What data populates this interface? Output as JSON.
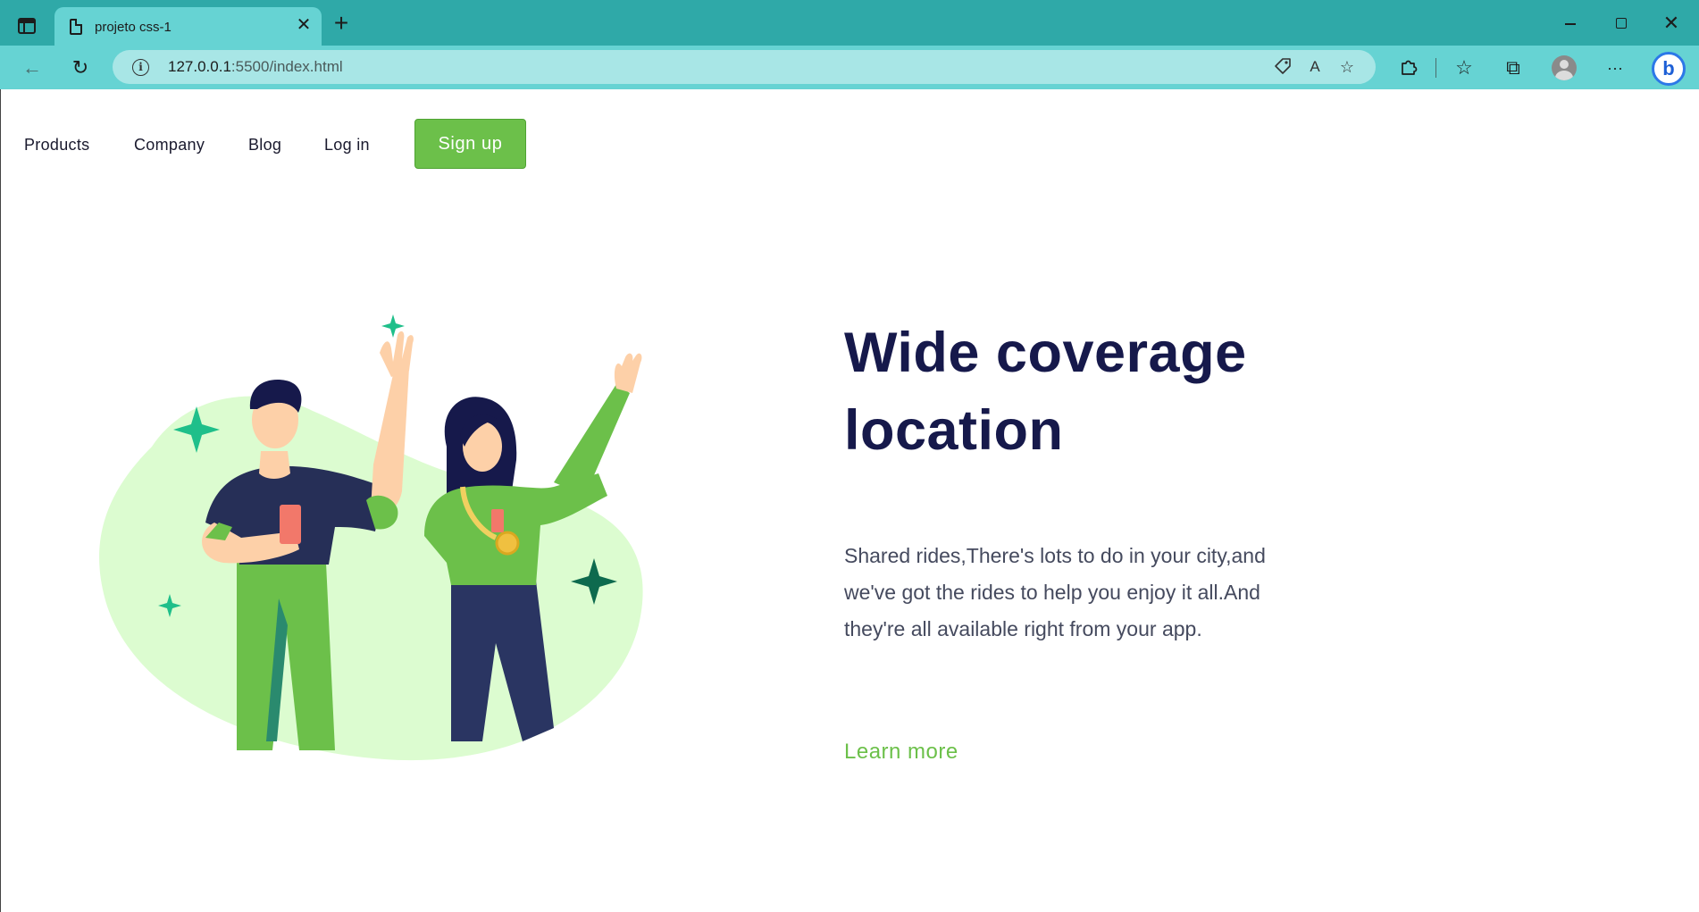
{
  "browser": {
    "tab_title": "projeto css-1",
    "url_host": "127.0.0.1",
    "url_path": ":5500/index.html",
    "icons": {
      "sidebar": "sidebar-icon",
      "tab": "page-icon",
      "close": "close-icon",
      "new_tab": "plus-icon",
      "back": "arrow-left-icon",
      "reload": "refresh-icon",
      "info": "info-icon",
      "coupon": "tag-icon",
      "read_aloud": "read-aloud-icon",
      "favorite_add": "star-plus-icon",
      "extensions": "puzzle-icon",
      "favorites": "star-list-icon",
      "collections": "collections-icon",
      "profile": "profile-icon",
      "more": "more-icon",
      "bing": "bing-icon"
    },
    "glyphs": {
      "close": "✕",
      "plus": "+",
      "back": "←",
      "reload": "↻",
      "info": "i",
      "tag": "⬡",
      "read": "A",
      "star_add": "☆",
      "puzzle": "⚙",
      "star_list": "☆",
      "collections": "⧉",
      "more": "···",
      "bing": "b"
    }
  },
  "nav": {
    "links": [
      "Products",
      "Company",
      "Blog",
      "Log in"
    ],
    "signup": "Sign up"
  },
  "hero": {
    "title_line1": "Wide coverage",
    "title_line2": "location",
    "description": "Shared rides,There's lots to do in your city,and we've got the rides to help you enjoy it all.And they're all available right from your app.",
    "cta": "Learn more"
  },
  "colors": {
    "titlebar": "#2fa9a8",
    "toolbar": "#66d3d3",
    "address_bar": "#a8e6e6",
    "accent_green": "#6cc04a",
    "heading_navy": "#16194b",
    "blob": "#dcfcd0",
    "sparkle": "#1fbf8a",
    "sparkle_dark": "#0e6a4e",
    "shirt_navy": "#262f57",
    "skin": "#fdd0a8"
  }
}
